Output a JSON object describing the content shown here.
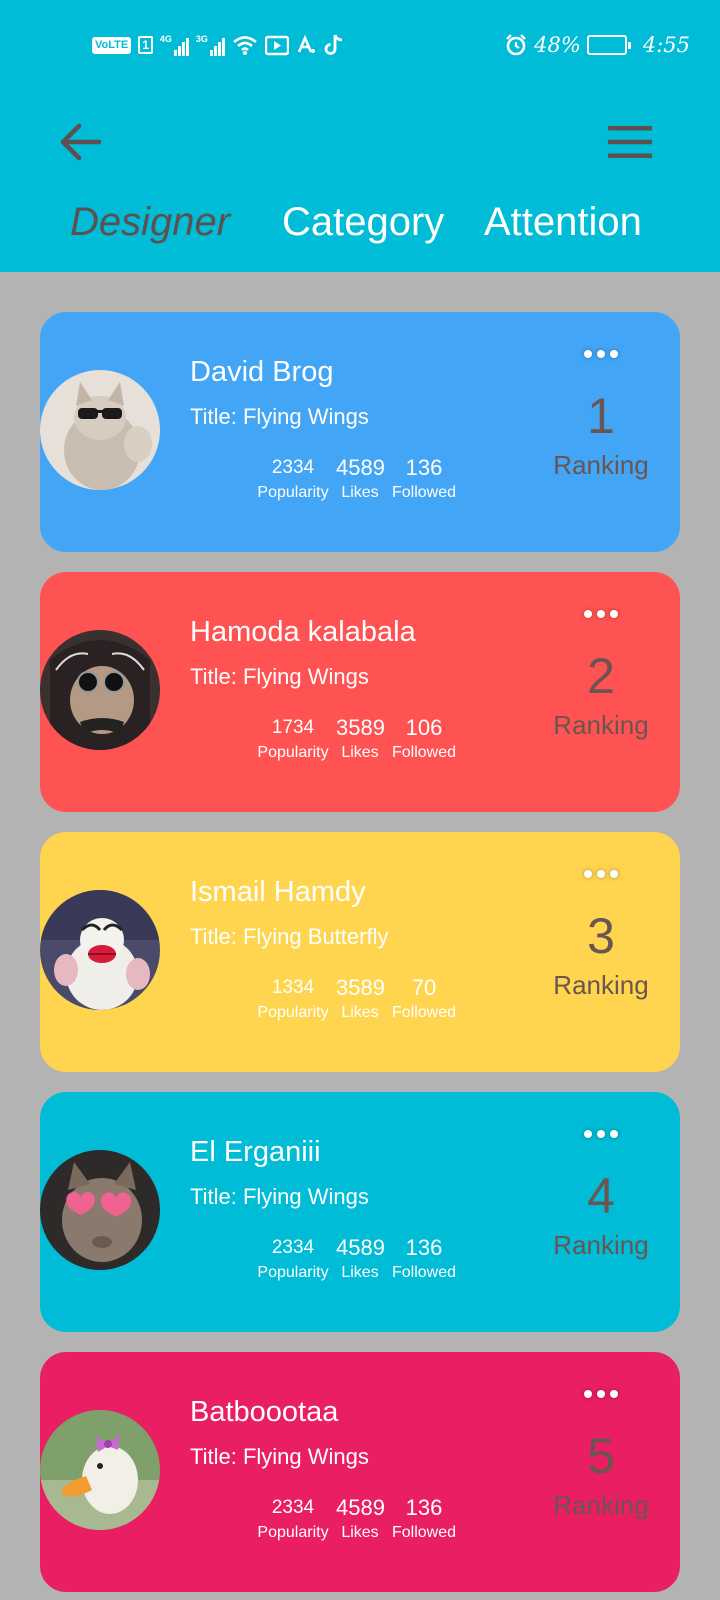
{
  "status_bar": {
    "left_icons": [
      "volte-icon",
      "sim-1-icon",
      "signal-4g-icon",
      "signal-3g-icon",
      "wifi-icon",
      "media-icon",
      "font-icon",
      "tiktok-icon"
    ],
    "volte_text": "VoLTE",
    "sim_text": "1",
    "net1_label": "4G",
    "net2_label": "3G",
    "alarm_icon": "alarm-icon",
    "battery_percent": "48%",
    "battery_level": 0.48,
    "time": "4:55"
  },
  "header": {
    "back_icon": "arrow-left-icon",
    "menu_icon": "hamburger-menu-icon",
    "colors": {
      "background": "#00bcd6",
      "icon": "#5d5050",
      "active_tab": "#5d5050",
      "tab": "#ffffff"
    },
    "tabs": [
      {
        "label": "Designer",
        "active": true
      },
      {
        "label": "Category",
        "active": false
      },
      {
        "label": "Attention",
        "active": false
      }
    ]
  },
  "cards": [
    {
      "name": "David Brog",
      "title": "Title: Flying Wings",
      "popularity": "2334",
      "likes": "4589",
      "followed": "136",
      "popularity_label": "Popularity",
      "likes_label": "Likes",
      "followed_label": "Followed",
      "rank": "1",
      "rank_label": "Ranking",
      "color": "#42a5f5",
      "avatar": "cat-with-sunglasses-avatar"
    },
    {
      "name": "Hamoda kalabala",
      "title": "Title: Flying Wings",
      "popularity": "1734",
      "likes": "3589",
      "followed": "106",
      "popularity_label": "Popularity",
      "likes_label": "Likes",
      "followed_label": "Followed",
      "rank": "2",
      "rank_label": "Ranking",
      "color": "#ff5252",
      "avatar": "cat-with-bandana-avatar"
    },
    {
      "name": "Ismail Hamdy",
      "title": "Title: Flying Butterfly",
      "popularity": "1334",
      "likes": "3589",
      "followed": "70",
      "popularity_label": "Popularity",
      "likes_label": "Likes",
      "followed_label": "Followed",
      "rank": "3",
      "rank_label": "Ranking",
      "color": "#ffd54f",
      "avatar": "duck-with-lips-avatar"
    },
    {
      "name": "El Erganiii",
      "title": "Title: Flying Wings",
      "popularity": "2334",
      "likes": "4589",
      "followed": "136",
      "popularity_label": "Popularity",
      "likes_label": "Likes",
      "followed_label": "Followed",
      "rank": "4",
      "rank_label": "Ranking",
      "color": "#00bcd6",
      "avatar": "cat-with-heart-glasses-avatar"
    },
    {
      "name": "Batboootaa",
      "title": "Title: Flying Wings",
      "popularity": "2334",
      "likes": "4589",
      "followed": "136",
      "popularity_label": "Popularity",
      "likes_label": "Likes",
      "followed_label": "Followed",
      "rank": "5",
      "rank_label": "Ranking",
      "color": "#e91e63",
      "avatar": "duck-with-bow-avatar"
    }
  ]
}
